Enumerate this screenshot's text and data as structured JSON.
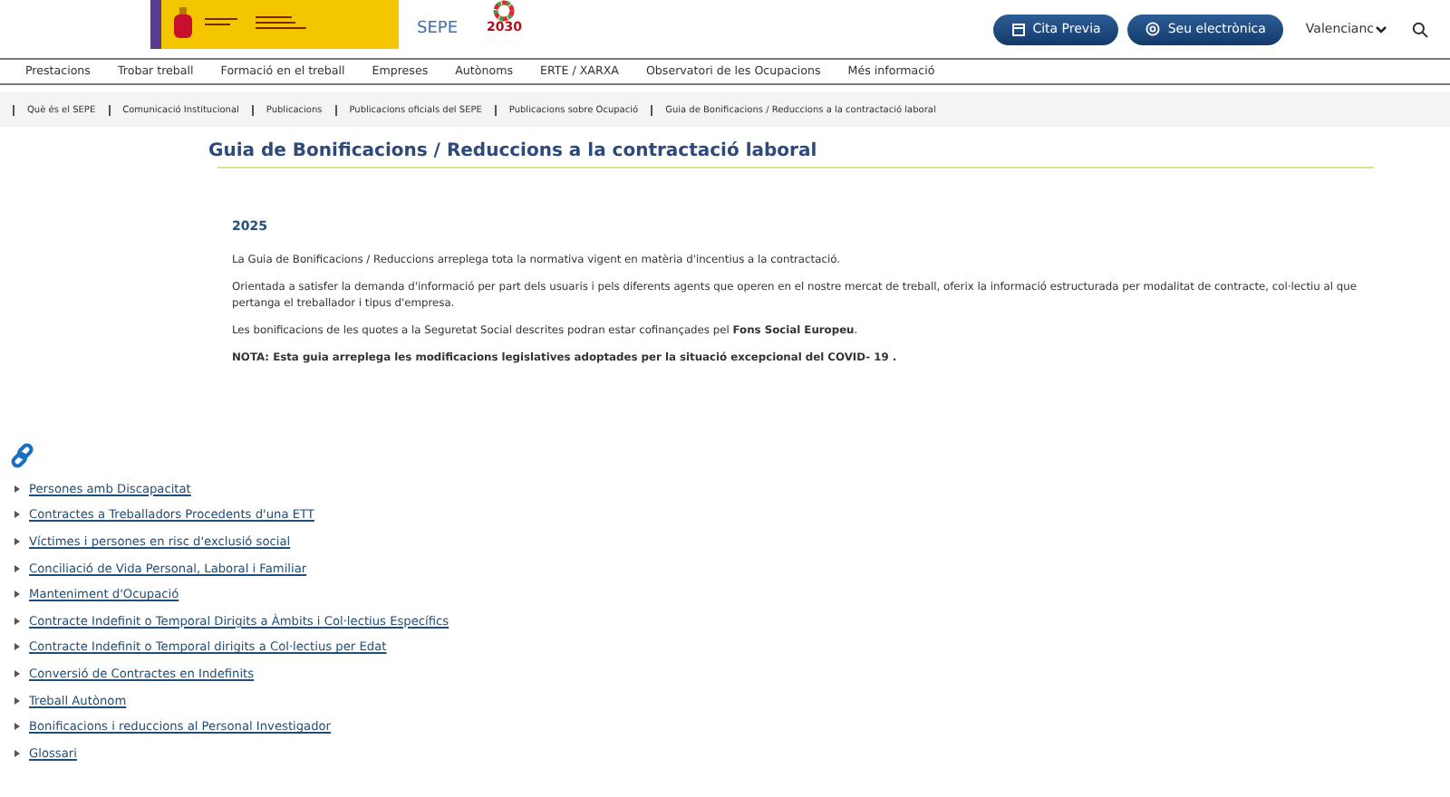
{
  "header": {
    "logo": {
      "sepe": "SEPE",
      "agenda_year": "2030"
    },
    "buttons": [
      {
        "label": "Cita Previa",
        "kind": "calendar"
      },
      {
        "label": "Seu electrònica",
        "kind": "at"
      }
    ],
    "language": "Valencianc"
  },
  "nav": [
    "Prestacions",
    "Trobar treball",
    "Formació en el treball",
    "Empreses",
    "Autònoms",
    "ERTE / XARXA",
    "Observatori de les Ocupacions",
    "Més informació"
  ],
  "breadcrumb": [
    "Què és el SEPE",
    "Comunicació Institucional",
    "Publicacions",
    "Publicacions oficials del SEPE",
    "Publicacions sobre Ocupació",
    "Guia de Bonificacions / Reduccions a la contractació laboral"
  ],
  "title": "Guia de Bonificacions / Reduccions a la contractació laboral",
  "year": "2025",
  "paragraphs": [
    "La Guia de Bonificacions / Reduccions arreplega tota la normativa vigent en matèria d'incentius a la contractació.",
    "Orientada a satisfer la demanda d'informació per part dels usuaris i pels diferents agents que operen en el nostre mercat de treball, oferix la informació estructurada per modalitat de contracte, col·lectiu al que pertanga el treballador i tipus d'empresa.",
    "Les bonificacions de les quotes a la Seguretat Social descrites podran estar cofinançades pel **Fons Social Europeu**.",
    "**NOTA: Esta guia arreplega les modificacions legislatives adoptades per la situació excepcional del COVID- 19 .**"
  ],
  "links": [
    "Persones amb Discapacitat",
    "Contractes a Treballadors Procedents d'una ETT",
    "Víctimes i persones en risc d'exclusió social",
    "Conciliació de Vida Personal, Laboral i Familiar",
    "Manteniment d'Ocupació",
    "Contracte Indefinit o Temporal Dirigits a Àmbits i Col·lectius Específics",
    "Contracte Indefinit o Temporal dirigits a Col·lectius per Edat",
    "Conversió de Contractes en Indefinits",
    "Treball Autònom",
    "Bonificacions i reduccions al Personal Investigador",
    "Glossari"
  ]
}
